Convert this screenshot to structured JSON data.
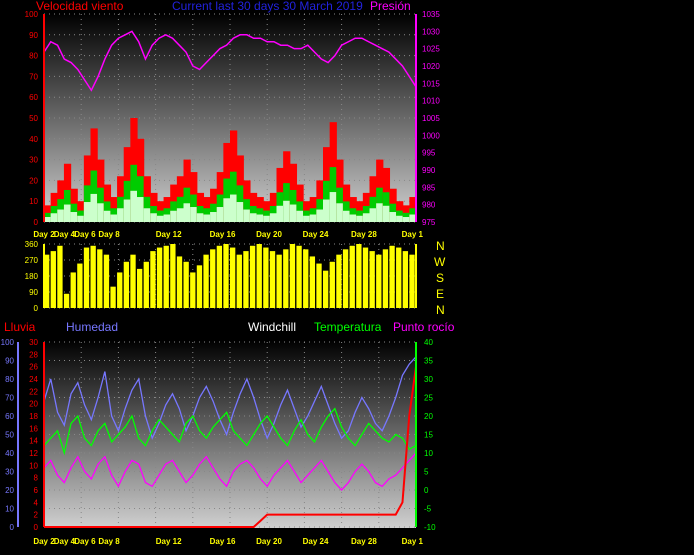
{
  "header": {
    "left_label": "Velocidad viento",
    "center_label": "Current last 30 days 30 March 2019",
    "right_label": "Presión"
  },
  "bottom_header": {
    "rain": "Lluvia",
    "humidity": "Humedad",
    "windchill": "Windchill",
    "temperature": "Temperatura",
    "dewpoint": "Punto rocío"
  },
  "compass_labels": [
    "N",
    "W",
    "S",
    "E",
    "N"
  ],
  "x_tick_labels": [
    "Day 2",
    "Day 4",
    "Day 6",
    "Day 8",
    "Day 12",
    "Day 16",
    "Day 20",
    "Day 24",
    "Day 28",
    "Day 1"
  ],
  "colors": {
    "wind_gust": "#ff0000",
    "wind_avg": "#00cc00",
    "wind_low": "#ccffcc",
    "pressure": "#ff00ff",
    "direction": "#ffff00",
    "humidity": "#7777ff",
    "temperature": "#00ff00",
    "dewpoint": "#ff00ff",
    "rain": "#ff0000",
    "axis_rain": "#ff0000",
    "axis_humidity": "#7777ff",
    "tick_x": "#ffff00"
  },
  "chart_data": [
    {
      "type": "line",
      "id": "wind_pressure",
      "title": "Current last 30 days 30 March 2019",
      "series": [
        {
          "name": "Velocidad viento",
          "axis": "left",
          "values": [
            8,
            14,
            20,
            28,
            16,
            10,
            32,
            45,
            30,
            18,
            12,
            22,
            36,
            50,
            40,
            22,
            14,
            10,
            12,
            18,
            22,
            30,
            24,
            14,
            12,
            16,
            24,
            38,
            44,
            32,
            20,
            14,
            12,
            10,
            14,
            26,
            34,
            28,
            18,
            10,
            12,
            20,
            36,
            48,
            30,
            18,
            12,
            10,
            14,
            22,
            30,
            26,
            16,
            10,
            8,
            12
          ]
        },
        {
          "name": "Presión",
          "axis": "right",
          "values": [
            1024,
            1027,
            1026,
            1022,
            1021,
            1019,
            1016,
            1013,
            1017,
            1022,
            1026,
            1028,
            1029,
            1030,
            1027,
            1022,
            1026,
            1028,
            1029,
            1028,
            1026,
            1024,
            1020,
            1019,
            1021,
            1023,
            1025,
            1026,
            1028,
            1029,
            1029,
            1028,
            1028,
            1027,
            1027,
            1026,
            1026,
            1025,
            1025,
            1026,
            1024,
            1022,
            1021,
            1023,
            1026,
            1027,
            1028,
            1028,
            1027,
            1026,
            1025,
            1024,
            1022,
            1020,
            1017,
            1014
          ]
        }
      ],
      "x_count": 56,
      "y_left": {
        "min": 0,
        "max": 100,
        "ticks": [
          0,
          10,
          20,
          30,
          40,
          50,
          60,
          70,
          80,
          90,
          100
        ]
      },
      "y_right": {
        "min": 975,
        "max": 1035,
        "ticks": [
          975,
          980,
          985,
          990,
          995,
          1000,
          1005,
          1010,
          1015,
          1020,
          1025,
          1030,
          1035
        ]
      }
    },
    {
      "type": "bar",
      "id": "wind_direction",
      "y": {
        "min": 0,
        "max": 360,
        "ticks": [
          0,
          90,
          180,
          270,
          360
        ]
      },
      "x_count": 56,
      "values": [
        300,
        320,
        350,
        80,
        200,
        250,
        340,
        350,
        330,
        300,
        120,
        200,
        260,
        300,
        220,
        260,
        320,
        340,
        350,
        360,
        290,
        260,
        200,
        240,
        300,
        330,
        350,
        360,
        340,
        300,
        320,
        350,
        360,
        340,
        320,
        300,
        330,
        360,
        350,
        330,
        290,
        250,
        210,
        260,
        300,
        330,
        350,
        360,
        340,
        320,
        300,
        330,
        350,
        340,
        320,
        300
      ]
    },
    {
      "type": "line",
      "id": "rain_humidity_temp",
      "series": [
        {
          "name": "Humedad",
          "axis": "left",
          "values": [
            68,
            80,
            62,
            55,
            72,
            78,
            66,
            58,
            70,
            84,
            60,
            52,
            64,
            74,
            80,
            60,
            48,
            56,
            66,
            72,
            64,
            52,
            60,
            70,
            76,
            68,
            58,
            50,
            62,
            72,
            80,
            70,
            58,
            48,
            56,
            66,
            74,
            64,
            54,
            60,
            68,
            76,
            66,
            56,
            48,
            52,
            62,
            70,
            64,
            56,
            52,
            60,
            70,
            82,
            88,
            92
          ]
        },
        {
          "name": "Temperatura",
          "axis": "right",
          "values": [
            12,
            14,
            16,
            10,
            18,
            20,
            14,
            12,
            16,
            18,
            13,
            15,
            17,
            20,
            14,
            12,
            16,
            19,
            17,
            15,
            13,
            18,
            20,
            16,
            14,
            17,
            19,
            21,
            16,
            14,
            12,
            15,
            18,
            20,
            17,
            14,
            12,
            16,
            19,
            15,
            13,
            17,
            20,
            22,
            17,
            14,
            12,
            15,
            18,
            16,
            14,
            13,
            15,
            14,
            11,
            12
          ]
        },
        {
          "name": "Punto rocío",
          "axis": "right",
          "values": [
            6,
            8,
            4,
            2,
            6,
            9,
            5,
            3,
            7,
            9,
            4,
            1,
            5,
            8,
            7,
            2,
            1,
            4,
            7,
            8,
            5,
            2,
            4,
            7,
            9,
            6,
            3,
            1,
            5,
            7,
            8,
            6,
            3,
            1,
            4,
            6,
            8,
            5,
            2,
            4,
            6,
            8,
            5,
            2,
            0,
            2,
            5,
            7,
            5,
            2,
            1,
            3,
            4,
            6,
            8,
            10
          ]
        },
        {
          "name": "Lluvia",
          "axis": "rain",
          "values": [
            0,
            0,
            0,
            0,
            0,
            0,
            0,
            0,
            0,
            0,
            0,
            0,
            0,
            0,
            0,
            0,
            0,
            0,
            0,
            0,
            0,
            0,
            0,
            0,
            0,
            0,
            0,
            0,
            0,
            0,
            0,
            0,
            1,
            2,
            2,
            2,
            2,
            2,
            2,
            2,
            2,
            2,
            2,
            2,
            2,
            2,
            2,
            2,
            2,
            2,
            2,
            2,
            2,
            4,
            18,
            26
          ]
        }
      ],
      "x_count": 56,
      "y_rain": {
        "min": 0,
        "max": 30,
        "ticks": [
          0,
          2,
          4,
          6,
          8,
          10,
          12,
          14,
          16,
          18,
          20,
          22,
          24,
          26,
          28,
          30
        ]
      },
      "y_humidity": {
        "min": 0,
        "max": 100,
        "ticks": [
          0,
          10,
          20,
          30,
          40,
          50,
          60,
          70,
          80,
          90,
          100
        ]
      },
      "y_right": {
        "min": -10,
        "max": 40,
        "ticks": [
          -10,
          -5,
          0,
          5,
          10,
          15,
          20,
          25,
          30,
          35,
          40
        ]
      }
    }
  ]
}
